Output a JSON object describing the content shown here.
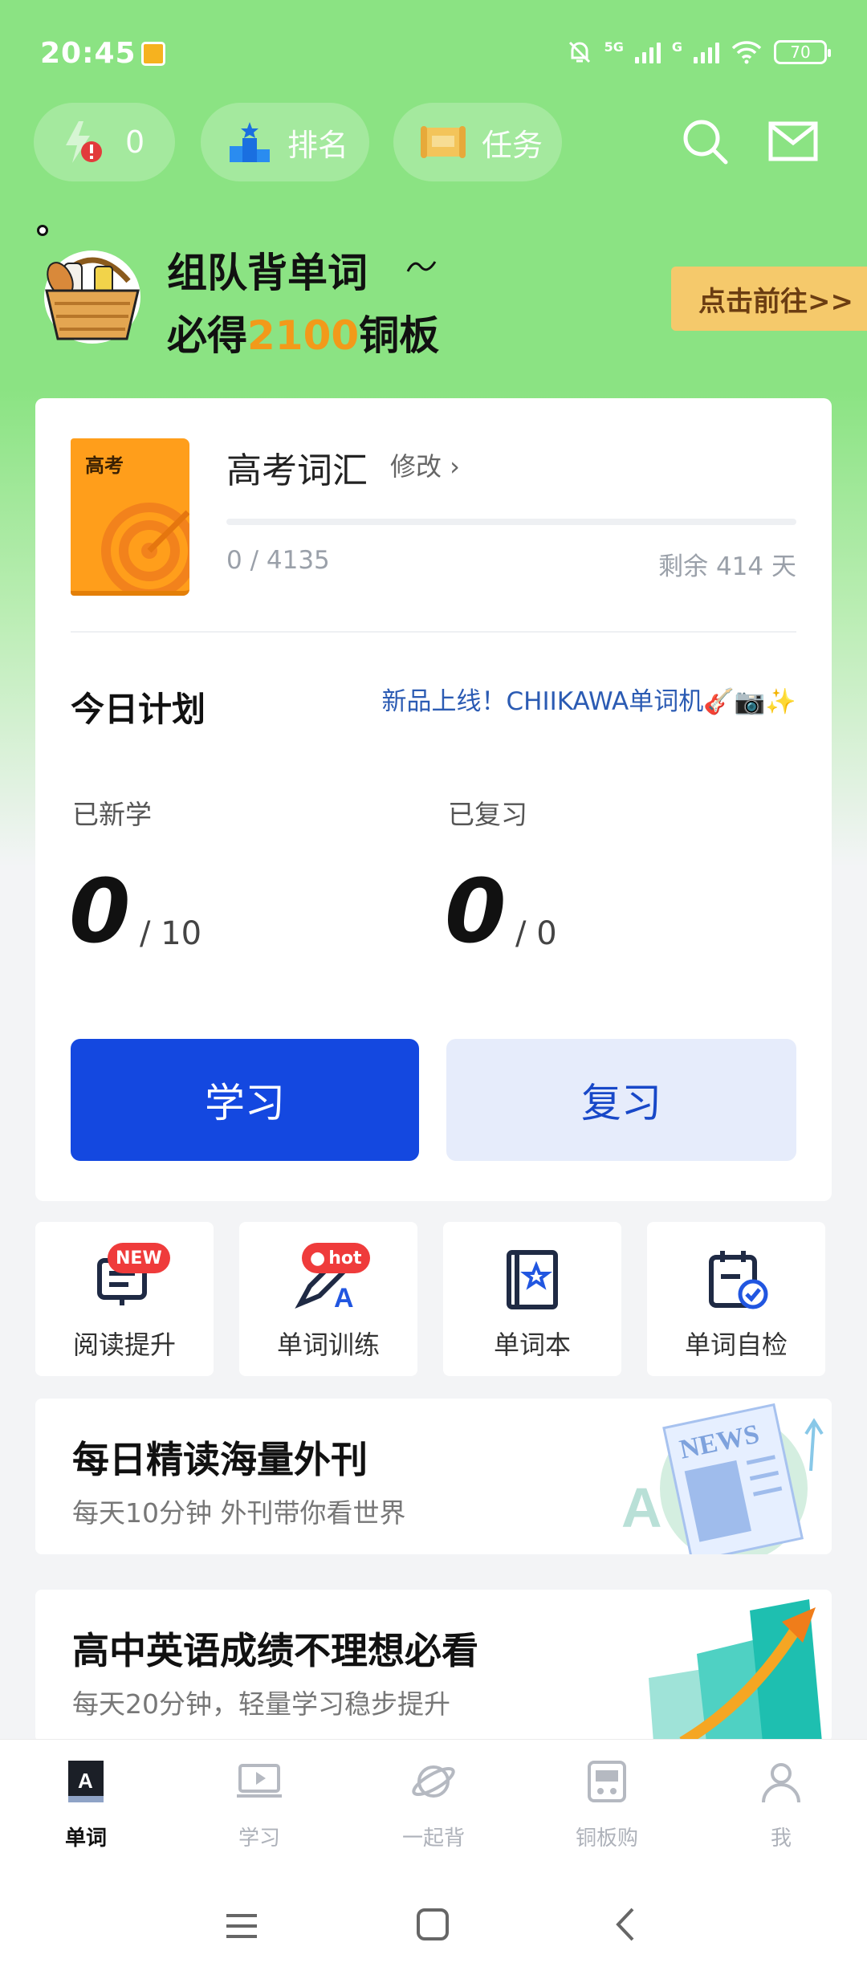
{
  "status": {
    "time": "20:45",
    "network_5g": "5G",
    "network_g": "G",
    "battery": "70"
  },
  "header": {
    "energy_count": "0",
    "rank_label": "排名",
    "task_label": "任务",
    "icons": [
      "search-icon",
      "mail-icon"
    ]
  },
  "banner": {
    "line1": "组队背单词",
    "line2_pre": "必得",
    "line2_num": "2100",
    "line2_post": "铜板",
    "goto_label": "点击前往>>"
  },
  "vocab": {
    "book_cover_label": "高考",
    "title": "高考词汇",
    "modify_label": "修改 ›",
    "progress_text": "0 / 4135",
    "progress_fraction": 0,
    "remaining_text": "剩余 414 天"
  },
  "plan": {
    "title": "今日计划",
    "promo": "新品上线！CHIIKAWA单词机🎸📷✨",
    "new_label": "已新学",
    "new_count": "0",
    "new_total": "/ 10",
    "review_label": "已复习",
    "review_count": "0",
    "review_total": "/ 0",
    "learn_button": "学习",
    "review_button": "复习"
  },
  "tiles": [
    {
      "label": "阅读提升",
      "badge": "NEW",
      "icon": "reading-icon"
    },
    {
      "label": "单词训练",
      "badge": "hot",
      "icon": "word-training-icon"
    },
    {
      "label": "单词本",
      "icon": "wordbook-icon"
    },
    {
      "label": "单词自检",
      "icon": "self-check-icon"
    }
  ],
  "cards": [
    {
      "title": "每日精读海量外刊",
      "subtitle": "每天10分钟 外刊带你看世界",
      "art_text": "NEWS"
    },
    {
      "title": "高中英语成绩不理想必看",
      "subtitle": "每天20分钟，轻量学习稳步提升"
    }
  ],
  "nav": [
    {
      "label": "单词",
      "icon": "word-tab-icon",
      "active": true
    },
    {
      "label": "学习",
      "icon": "study-tab-icon",
      "active": false
    },
    {
      "label": "一起背",
      "icon": "planet-tab-icon",
      "active": false
    },
    {
      "label": "铜板购",
      "icon": "shop-tab-icon",
      "active": false
    },
    {
      "label": "我",
      "icon": "profile-tab-icon",
      "active": false
    }
  ],
  "colors": {
    "header_green": "#8be383",
    "primary_blue": "#1448e0",
    "secondary_blue": "#e6ecfb",
    "accent_orange": "#f29a1a"
  }
}
